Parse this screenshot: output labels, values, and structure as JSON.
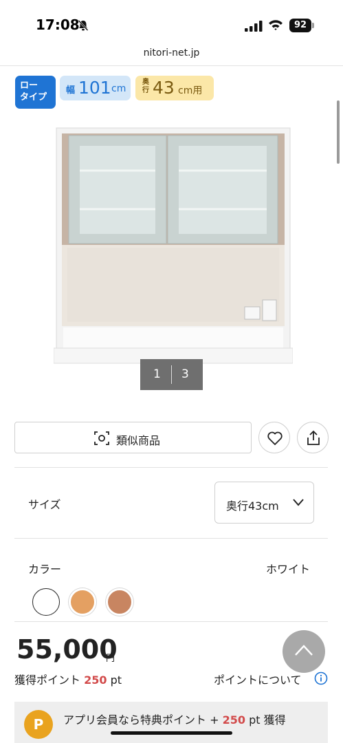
{
  "status_bar": {
    "time": "17:08",
    "battery": "92",
    "icons": [
      "bell-slash-icon",
      "signal-icon",
      "wifi-icon",
      "battery-icon"
    ]
  },
  "browser": {
    "url": "nitori-net.jp"
  },
  "badges": {
    "low_type_line1": "ロー",
    "low_type_line2": "タイプ",
    "width_prefix": "幅",
    "width_value": "101",
    "width_unit": "cm",
    "depth_prefix": "奥行",
    "depth_value": "43",
    "depth_unit": "cm用"
  },
  "gallery": {
    "current": "1",
    "total": "3"
  },
  "actions": {
    "similar_label": "類似商品",
    "favorite_icon": "heart-icon",
    "share_icon": "share-icon"
  },
  "size": {
    "label": "サイズ",
    "selected": "奥行43cm"
  },
  "color": {
    "label": "カラー",
    "selected": "ホワイト",
    "swatches": [
      "#ffffff",
      "#e4a062",
      "#c88561"
    ]
  },
  "price": {
    "value": "55,000",
    "unit": "円"
  },
  "points": {
    "prefix": "獲得ポイント",
    "value": "250",
    "unit": "pt",
    "link": "ポイントについて"
  },
  "promo": {
    "coin": "P",
    "text_prefix": "アプリ会員なら特典ポイント +",
    "points": "250",
    "text_suffix": "pt 獲得"
  },
  "colors": {
    "accent_blue": "#1f74d4",
    "points_red": "#d24a4a",
    "coin_gold": "#e9a31f"
  }
}
